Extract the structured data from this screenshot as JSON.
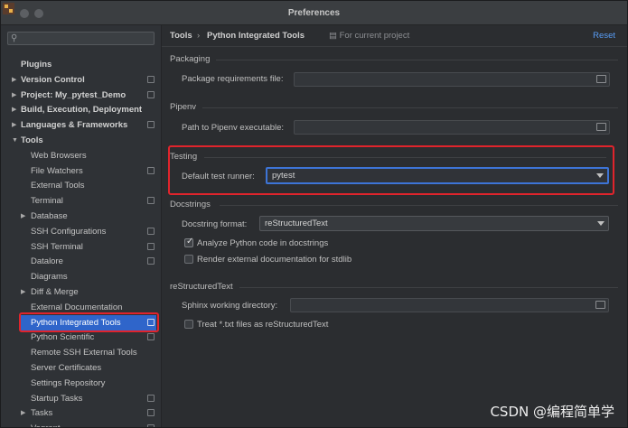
{
  "window": {
    "title": "Preferences"
  },
  "search": {
    "placeholder": ""
  },
  "sidebar": {
    "items": [
      {
        "label": "Plugins",
        "bold": true,
        "arrow": "",
        "indent": 0,
        "proj": false
      },
      {
        "label": "Version Control",
        "bold": true,
        "arrow": "▶",
        "indent": 0,
        "proj": true
      },
      {
        "label": "Project: My_pytest_Demo",
        "bold": true,
        "arrow": "▶",
        "indent": 0,
        "proj": true
      },
      {
        "label": "Build, Execution, Deployment",
        "bold": true,
        "arrow": "▶",
        "indent": 0,
        "proj": false
      },
      {
        "label": "Languages & Frameworks",
        "bold": true,
        "arrow": "▶",
        "indent": 0,
        "proj": true
      },
      {
        "label": "Tools",
        "bold": true,
        "arrow": "▼",
        "indent": 0,
        "proj": false
      },
      {
        "label": "Web Browsers",
        "bold": false,
        "arrow": "",
        "indent": 1,
        "proj": false
      },
      {
        "label": "File Watchers",
        "bold": false,
        "arrow": "",
        "indent": 1,
        "proj": true
      },
      {
        "label": "External Tools",
        "bold": false,
        "arrow": "",
        "indent": 1,
        "proj": false
      },
      {
        "label": "Terminal",
        "bold": false,
        "arrow": "",
        "indent": 1,
        "proj": true
      },
      {
        "label": "Database",
        "bold": false,
        "arrow": "▶",
        "indent": 1,
        "proj": false
      },
      {
        "label": "SSH Configurations",
        "bold": false,
        "arrow": "",
        "indent": 1,
        "proj": true
      },
      {
        "label": "SSH Terminal",
        "bold": false,
        "arrow": "",
        "indent": 1,
        "proj": true
      },
      {
        "label": "Datalore",
        "bold": false,
        "arrow": "",
        "indent": 1,
        "proj": true
      },
      {
        "label": "Diagrams",
        "bold": false,
        "arrow": "",
        "indent": 1,
        "proj": false
      },
      {
        "label": "Diff & Merge",
        "bold": false,
        "arrow": "▶",
        "indent": 1,
        "proj": false
      },
      {
        "label": "External Documentation",
        "bold": false,
        "arrow": "",
        "indent": 1,
        "proj": false
      },
      {
        "label": "Python Integrated Tools",
        "bold": false,
        "arrow": "",
        "indent": 1,
        "proj": true,
        "selected": true
      },
      {
        "label": "Python Scientific",
        "bold": false,
        "arrow": "",
        "indent": 1,
        "proj": true
      },
      {
        "label": "Remote SSH External Tools",
        "bold": false,
        "arrow": "",
        "indent": 1,
        "proj": false
      },
      {
        "label": "Server Certificates",
        "bold": false,
        "arrow": "",
        "indent": 1,
        "proj": false
      },
      {
        "label": "Settings Repository",
        "bold": false,
        "arrow": "",
        "indent": 1,
        "proj": false
      },
      {
        "label": "Startup Tasks",
        "bold": false,
        "arrow": "",
        "indent": 1,
        "proj": true
      },
      {
        "label": "Tasks",
        "bold": false,
        "arrow": "▶",
        "indent": 1,
        "proj": true
      },
      {
        "label": "Vagrant",
        "bold": false,
        "arrow": "",
        "indent": 1,
        "proj": true
      }
    ]
  },
  "header": {
    "crumb_parent": "Tools",
    "crumb_separator": "›",
    "crumb_current": "Python Integrated Tools",
    "scope": "For current project",
    "reset": "Reset"
  },
  "packaging": {
    "title": "Packaging",
    "requirements_label": "Package requirements file:",
    "requirements_value": ""
  },
  "pipenv": {
    "title": "Pipenv",
    "path_label": "Path to Pipenv executable:",
    "path_value": ""
  },
  "testing": {
    "title": "Testing",
    "runner_label": "Default test runner:",
    "runner_value": "pytest"
  },
  "docstrings": {
    "title": "Docstrings",
    "format_label": "Docstring format:",
    "format_value": "reStructuredText",
    "analyze_label": "Analyze Python code in docstrings",
    "analyze_checked": true,
    "render_label": "Render external documentation for stdlib",
    "render_checked": false
  },
  "restructured": {
    "title": "reStructuredText",
    "sphinx_label": "Sphinx working directory:",
    "sphinx_value": "",
    "treat_label": "Treat *.txt files as reStructuredText",
    "treat_checked": false
  },
  "watermark": "CSDN @编程简单学",
  "colors": {
    "accent": "#2f65ca",
    "highlight": "#e0242c",
    "link": "#589df6"
  }
}
